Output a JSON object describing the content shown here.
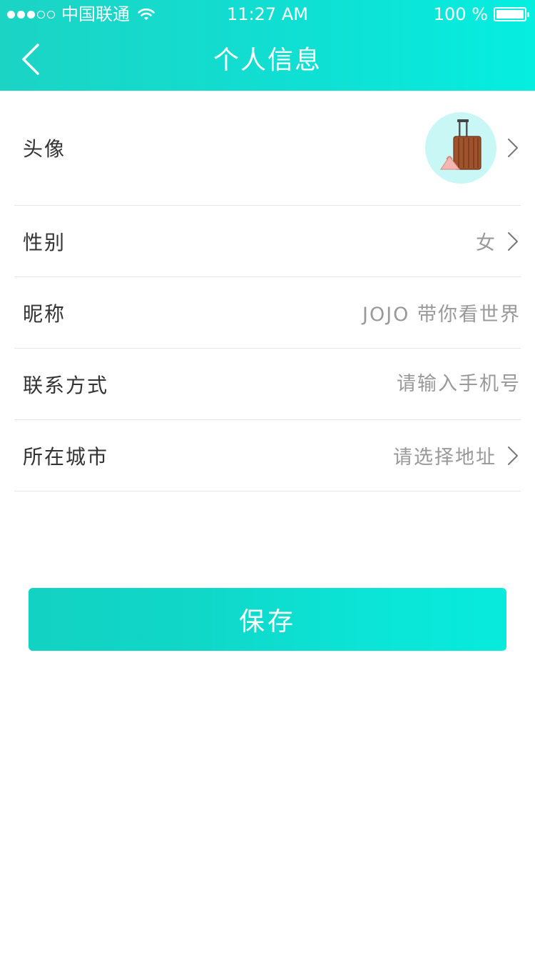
{
  "status_bar": {
    "carrier": "中国联通",
    "time": "11:27 AM",
    "battery": "100 %"
  },
  "nav": {
    "title": "个人信息",
    "back_icon": "chevron-left-icon"
  },
  "rows": {
    "avatar": {
      "label": "头像"
    },
    "gender": {
      "label": "性别",
      "value": "女"
    },
    "nickname": {
      "label": "昵称",
      "value": "JOJO 带你看世界"
    },
    "contact": {
      "label": "联系方式",
      "placeholder": "请输入手机号"
    },
    "city": {
      "label": "所在城市",
      "placeholder": "请选择地址"
    }
  },
  "save_button": {
    "label": "保存"
  },
  "colors": {
    "accent": "#12d4c5",
    "header_gradient_end": "#05eee0",
    "avatar_bg": "#c9f7f5",
    "divider": "#e6e6e6",
    "value_text": "#999999"
  }
}
